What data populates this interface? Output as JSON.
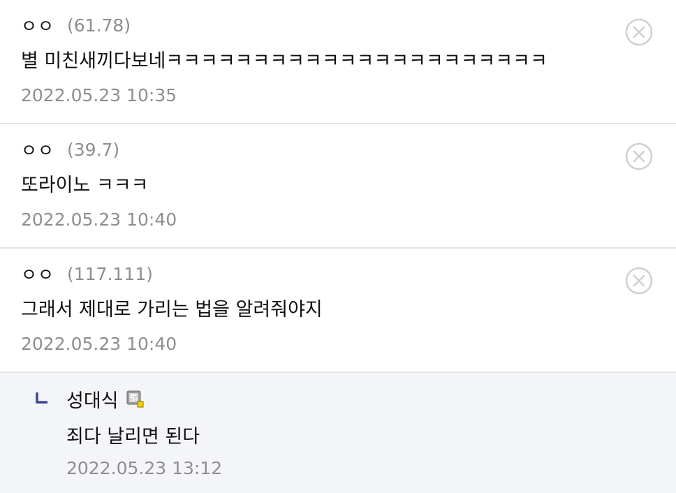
{
  "comments": [
    {
      "nickname": "ㅇㅇ",
      "ip": "(61.78)",
      "text": "별 미친새끼다보네ㅋㅋㅋㅋㅋㅋㅋㅋㅋㅋㅋㅋㅋㅋㅋㅋㅋㅋㅋㅋㅋㅋ",
      "date": "2022.05.23 10:35"
    },
    {
      "nickname": "ㅇㅇ",
      "ip": "(39.7)",
      "text": "또라이노 ㅋㅋㅋ",
      "date": "2022.05.23 10:40"
    },
    {
      "nickname": "ㅇㅇ",
      "ip": "(117.111)",
      "text": "그래서 제대로 가리는 법을 알려줘야지",
      "date": "2022.05.23 10:40"
    }
  ],
  "reply": {
    "nickname": "성대식",
    "text": "죄다 날리면 된다",
    "date": "2022.05.23 13:12"
  },
  "icons": {
    "delete": "close-circle-icon",
    "reply_arrow": "reply-arrow-icon",
    "gallog": "gallog-icon"
  },
  "colors": {
    "text": "#111111",
    "muted": "#8e8e8e",
    "divider": "#e2e3e8",
    "reply_bg": "#f4f5f9",
    "reply_arrow": "#3b4890"
  }
}
